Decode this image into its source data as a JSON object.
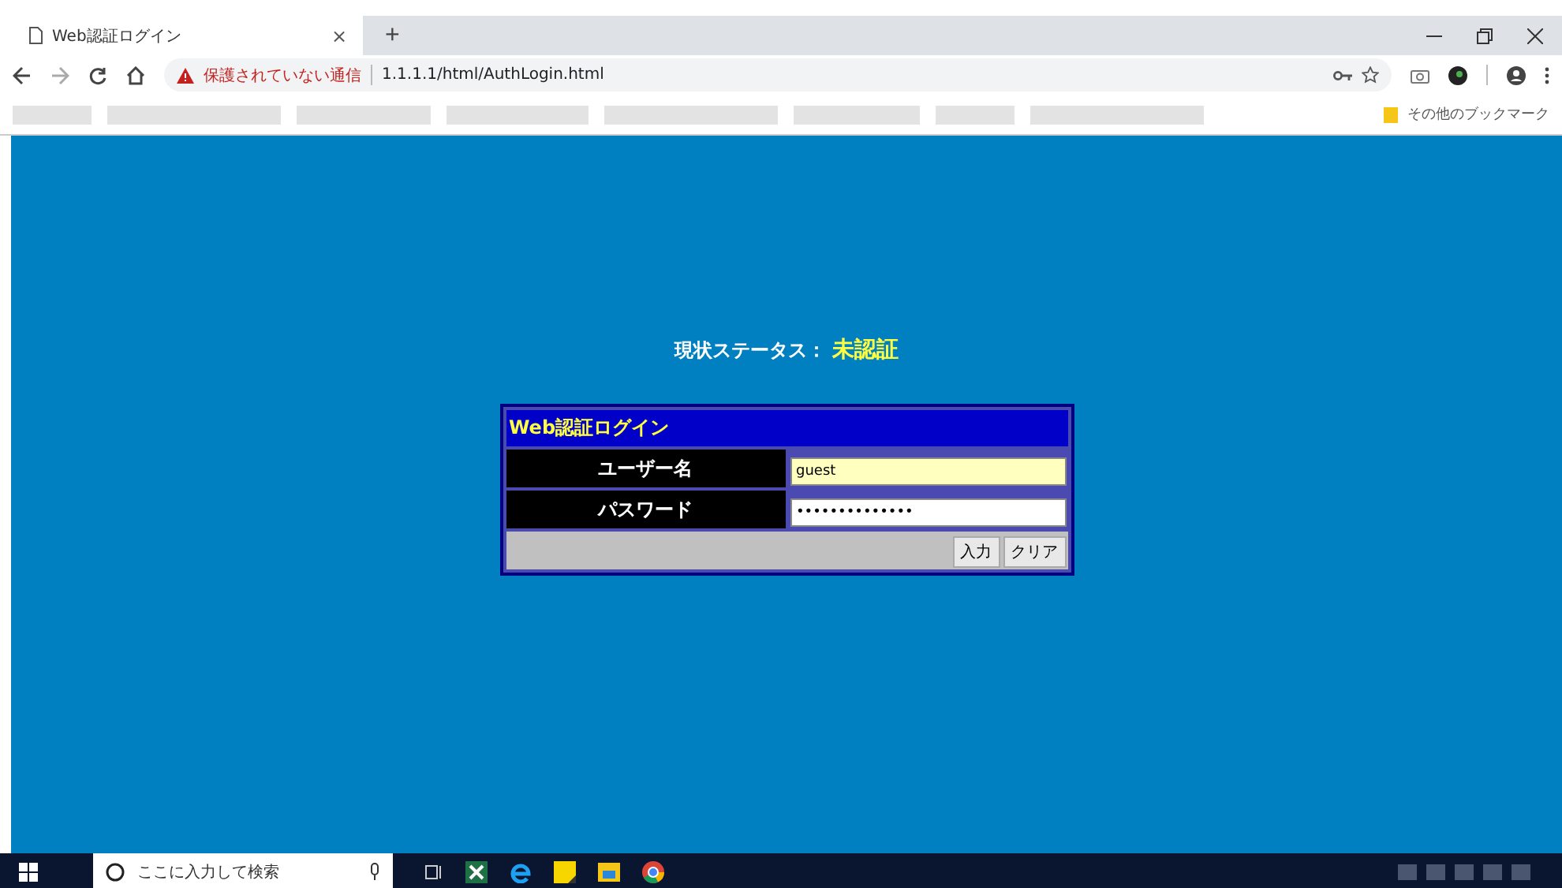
{
  "browser": {
    "tab_title": "Web認証ログイン",
    "tab_close": "×",
    "new_tab": "+",
    "security_warning": "保護されていない通信",
    "url": "1.1.1.1/html/AuthLogin.html",
    "other_bookmarks": "その他のブックマーク"
  },
  "page": {
    "status_label": "現状ステータス：",
    "status_value": "未認証",
    "form": {
      "title": "Web認証ログイン",
      "fields": [
        {
          "label": "ユーザー名",
          "value": "guest",
          "highlighted": true
        },
        {
          "label": "パスワード",
          "value": "••••••••••••••",
          "highlighted": false
        }
      ],
      "buttons": [
        "入力",
        "クリア"
      ]
    }
  },
  "taskbar": {
    "search_placeholder": "ここに入力して検索"
  }
}
